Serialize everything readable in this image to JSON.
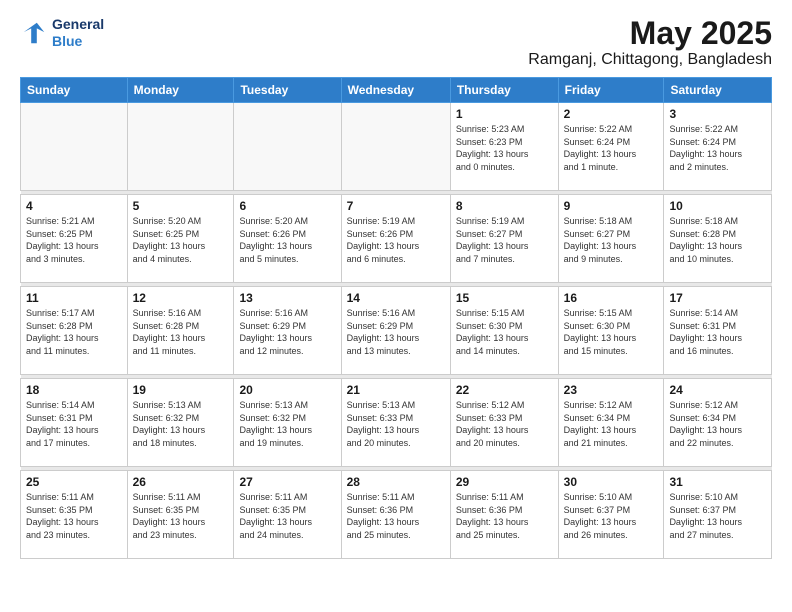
{
  "header": {
    "logo_line1": "General",
    "logo_line2": "Blue",
    "title": "May 2025",
    "subtitle": "Ramganj, Chittagong, Bangladesh"
  },
  "weekdays": [
    "Sunday",
    "Monday",
    "Tuesday",
    "Wednesday",
    "Thursday",
    "Friday",
    "Saturday"
  ],
  "weeks": [
    [
      {
        "day": "",
        "info": ""
      },
      {
        "day": "",
        "info": ""
      },
      {
        "day": "",
        "info": ""
      },
      {
        "day": "",
        "info": ""
      },
      {
        "day": "1",
        "info": "Sunrise: 5:23 AM\nSunset: 6:23 PM\nDaylight: 13 hours\nand 0 minutes."
      },
      {
        "day": "2",
        "info": "Sunrise: 5:22 AM\nSunset: 6:24 PM\nDaylight: 13 hours\nand 1 minute."
      },
      {
        "day": "3",
        "info": "Sunrise: 5:22 AM\nSunset: 6:24 PM\nDaylight: 13 hours\nand 2 minutes."
      }
    ],
    [
      {
        "day": "4",
        "info": "Sunrise: 5:21 AM\nSunset: 6:25 PM\nDaylight: 13 hours\nand 3 minutes."
      },
      {
        "day": "5",
        "info": "Sunrise: 5:20 AM\nSunset: 6:25 PM\nDaylight: 13 hours\nand 4 minutes."
      },
      {
        "day": "6",
        "info": "Sunrise: 5:20 AM\nSunset: 6:26 PM\nDaylight: 13 hours\nand 5 minutes."
      },
      {
        "day": "7",
        "info": "Sunrise: 5:19 AM\nSunset: 6:26 PM\nDaylight: 13 hours\nand 6 minutes."
      },
      {
        "day": "8",
        "info": "Sunrise: 5:19 AM\nSunset: 6:27 PM\nDaylight: 13 hours\nand 7 minutes."
      },
      {
        "day": "9",
        "info": "Sunrise: 5:18 AM\nSunset: 6:27 PM\nDaylight: 13 hours\nand 9 minutes."
      },
      {
        "day": "10",
        "info": "Sunrise: 5:18 AM\nSunset: 6:28 PM\nDaylight: 13 hours\nand 10 minutes."
      }
    ],
    [
      {
        "day": "11",
        "info": "Sunrise: 5:17 AM\nSunset: 6:28 PM\nDaylight: 13 hours\nand 11 minutes."
      },
      {
        "day": "12",
        "info": "Sunrise: 5:16 AM\nSunset: 6:28 PM\nDaylight: 13 hours\nand 11 minutes."
      },
      {
        "day": "13",
        "info": "Sunrise: 5:16 AM\nSunset: 6:29 PM\nDaylight: 13 hours\nand 12 minutes."
      },
      {
        "day": "14",
        "info": "Sunrise: 5:16 AM\nSunset: 6:29 PM\nDaylight: 13 hours\nand 13 minutes."
      },
      {
        "day": "15",
        "info": "Sunrise: 5:15 AM\nSunset: 6:30 PM\nDaylight: 13 hours\nand 14 minutes."
      },
      {
        "day": "16",
        "info": "Sunrise: 5:15 AM\nSunset: 6:30 PM\nDaylight: 13 hours\nand 15 minutes."
      },
      {
        "day": "17",
        "info": "Sunrise: 5:14 AM\nSunset: 6:31 PM\nDaylight: 13 hours\nand 16 minutes."
      }
    ],
    [
      {
        "day": "18",
        "info": "Sunrise: 5:14 AM\nSunset: 6:31 PM\nDaylight: 13 hours\nand 17 minutes."
      },
      {
        "day": "19",
        "info": "Sunrise: 5:13 AM\nSunset: 6:32 PM\nDaylight: 13 hours\nand 18 minutes."
      },
      {
        "day": "20",
        "info": "Sunrise: 5:13 AM\nSunset: 6:32 PM\nDaylight: 13 hours\nand 19 minutes."
      },
      {
        "day": "21",
        "info": "Sunrise: 5:13 AM\nSunset: 6:33 PM\nDaylight: 13 hours\nand 20 minutes."
      },
      {
        "day": "22",
        "info": "Sunrise: 5:12 AM\nSunset: 6:33 PM\nDaylight: 13 hours\nand 20 minutes."
      },
      {
        "day": "23",
        "info": "Sunrise: 5:12 AM\nSunset: 6:34 PM\nDaylight: 13 hours\nand 21 minutes."
      },
      {
        "day": "24",
        "info": "Sunrise: 5:12 AM\nSunset: 6:34 PM\nDaylight: 13 hours\nand 22 minutes."
      }
    ],
    [
      {
        "day": "25",
        "info": "Sunrise: 5:11 AM\nSunset: 6:35 PM\nDaylight: 13 hours\nand 23 minutes."
      },
      {
        "day": "26",
        "info": "Sunrise: 5:11 AM\nSunset: 6:35 PM\nDaylight: 13 hours\nand 23 minutes."
      },
      {
        "day": "27",
        "info": "Sunrise: 5:11 AM\nSunset: 6:35 PM\nDaylight: 13 hours\nand 24 minutes."
      },
      {
        "day": "28",
        "info": "Sunrise: 5:11 AM\nSunset: 6:36 PM\nDaylight: 13 hours\nand 25 minutes."
      },
      {
        "day": "29",
        "info": "Sunrise: 5:11 AM\nSunset: 6:36 PM\nDaylight: 13 hours\nand 25 minutes."
      },
      {
        "day": "30",
        "info": "Sunrise: 5:10 AM\nSunset: 6:37 PM\nDaylight: 13 hours\nand 26 minutes."
      },
      {
        "day": "31",
        "info": "Sunrise: 5:10 AM\nSunset: 6:37 PM\nDaylight: 13 hours\nand 27 minutes."
      }
    ]
  ]
}
